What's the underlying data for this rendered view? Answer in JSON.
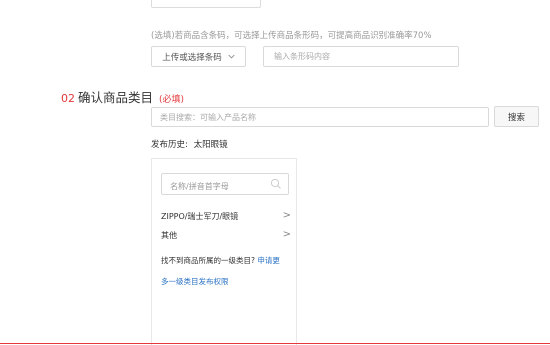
{
  "barcode": {
    "hint": "(选填)若商品含条码，可选择上传商品条形码，可提高商品识别准确率70%",
    "upload_label": "上传或选择条码",
    "input_placeholder": "输入条形码内容",
    "input_value": ""
  },
  "category": {
    "num": "02",
    "title": "确认商品类目",
    "required": "(必填)",
    "search_placeholder": "类目搜索：可输入产品名称",
    "search_value": "",
    "search_button": "搜索",
    "history_label": "发布历史:",
    "history_items": [
      "太阳眼镜"
    ]
  },
  "panel": {
    "search_placeholder": "名称/拼音首字母",
    "items": [
      {
        "label": "ZIPPO/瑞士军刀/眼镜",
        "arrow": ">"
      },
      {
        "label": "其他",
        "arrow": ">"
      }
    ],
    "notfound_text": "找不到商品所属的一级类目?",
    "notfound_link": "申请更",
    "multi_link": "多一级类目发布权限"
  },
  "colors": {
    "accent_red": "#e4393c",
    "link_blue": "#2a72c5"
  },
  "icons": {
    "chevron": "chevron-down-icon",
    "search": "search-icon"
  }
}
